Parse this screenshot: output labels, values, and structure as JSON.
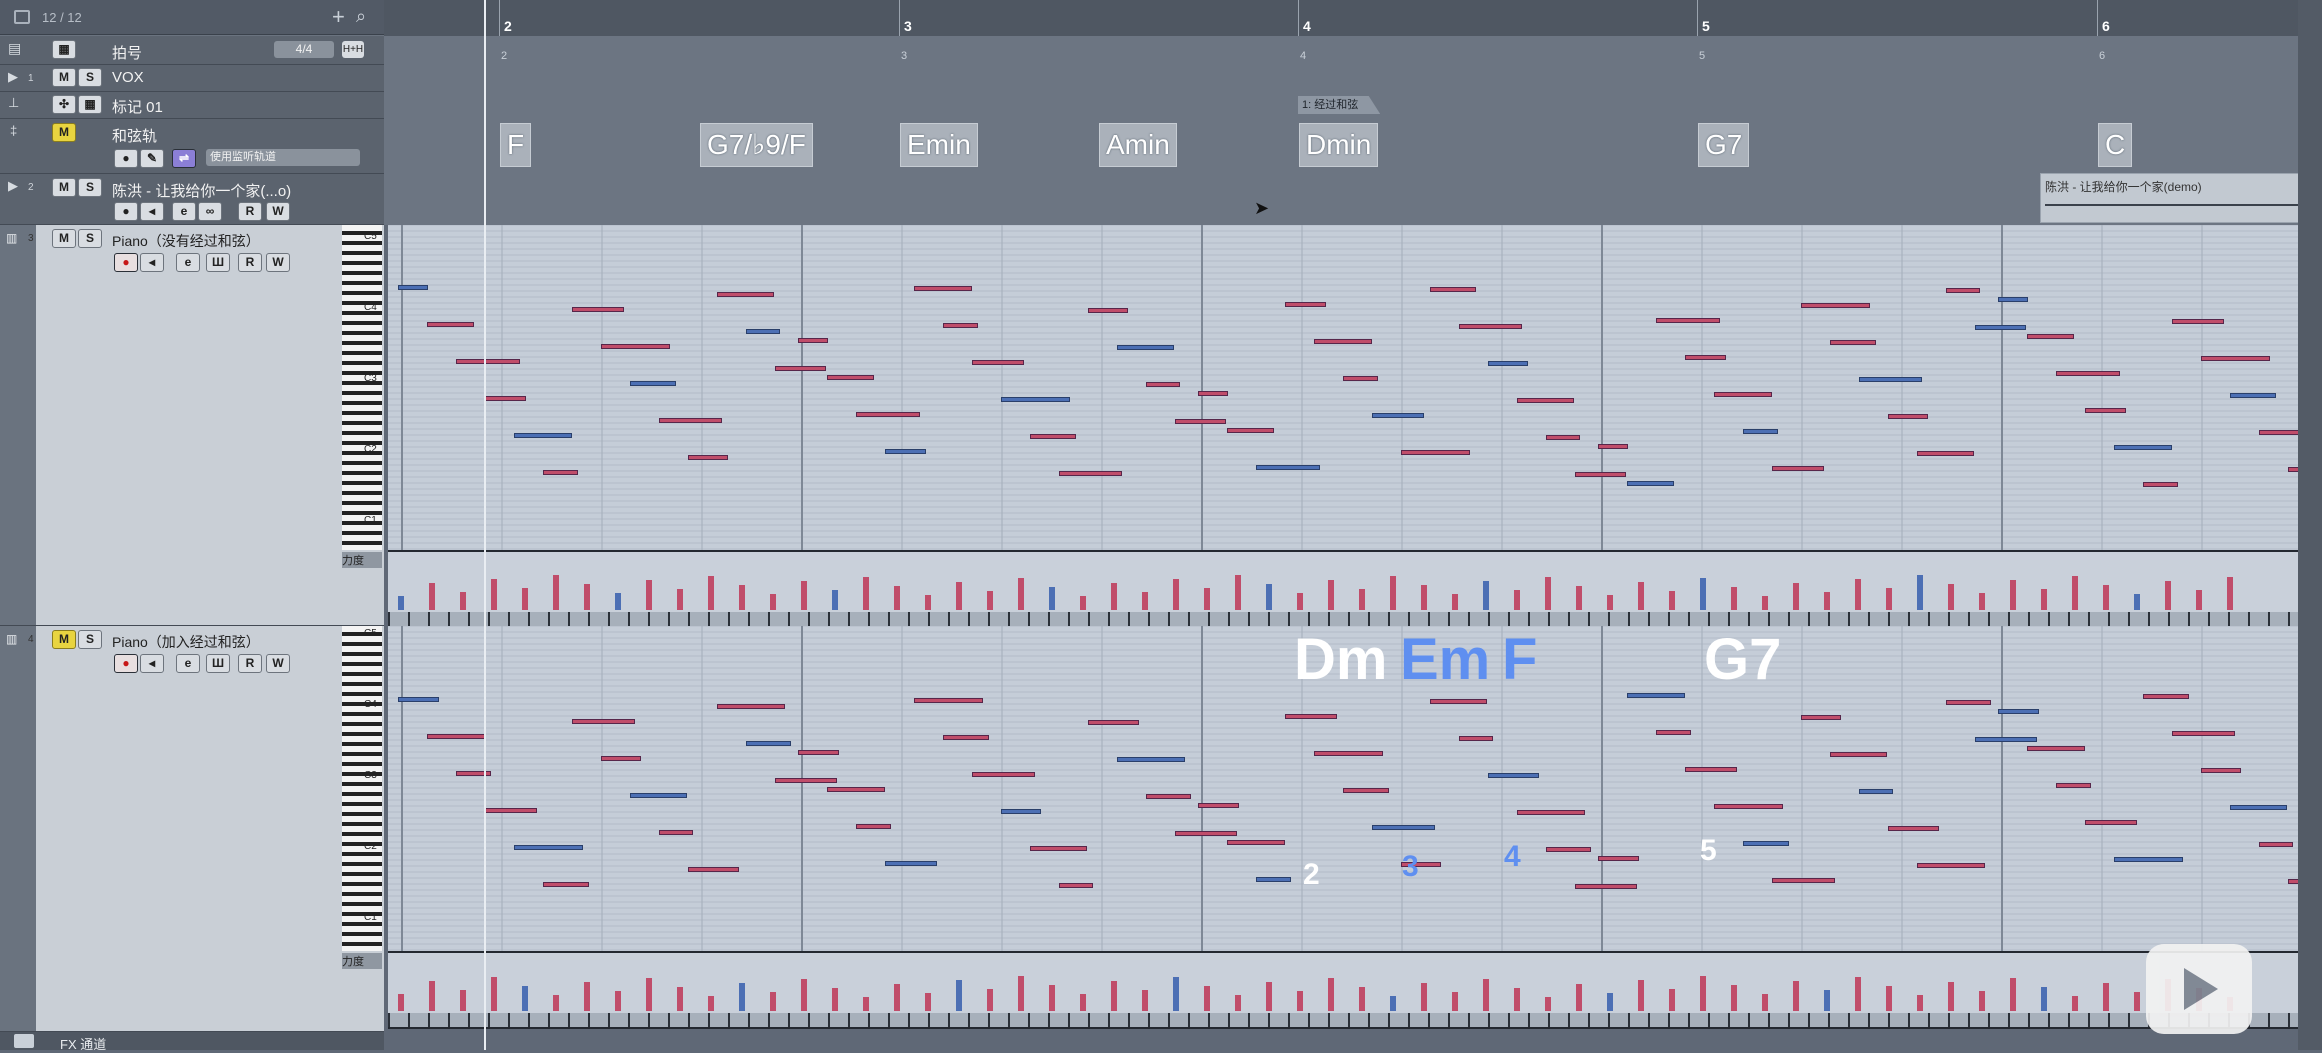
{
  "header": {
    "track_count": "12 / 12",
    "signature_label": "拍号",
    "signature_value": "4/4",
    "add_icon": "plus-icon",
    "search_icon": "search-icon"
  },
  "tracks": {
    "vox": {
      "number": "1",
      "name": "VOX"
    },
    "marker": {
      "name": "标记 01"
    },
    "chord": {
      "name": "和弦轨",
      "monitor_label": "使用监听轨道"
    },
    "audio": {
      "number": "2",
      "name": "陈洪 - 让我给你一个家(...o)"
    },
    "piano1": {
      "number": "3",
      "name": "Piano（没有经过和弦）"
    },
    "piano2": {
      "number": "4",
      "name": "Piano（加入经过和弦）"
    }
  },
  "buttons": {
    "m": "M",
    "s": "S",
    "r": "R",
    "w": "W",
    "e": "e"
  },
  "footer": {
    "fx_label": "FX 通道"
  },
  "ruler": {
    "bars": [
      "2",
      "3",
      "4",
      "5",
      "6"
    ],
    "sub_bars": [
      "2",
      "3",
      "4",
      "5",
      "6"
    ]
  },
  "marker_event": "1: 经过和弦",
  "chords": [
    "F",
    "G7/♭9/F",
    "Emin",
    "Amin",
    "Dmin",
    "G7",
    "C"
  ],
  "audio_event": "陈洪 - 让我给你一个家(demo)",
  "keyboard": {
    "octaves_top": [
      "C5",
      "C4",
      "C3",
      "C2",
      "C1"
    ],
    "octaves_bottom": [
      "C5",
      "C4",
      "C3",
      "C2",
      "C1"
    ],
    "velocity_label": "力度"
  },
  "annotations": {
    "passing_chords": [
      "Dm",
      "Em",
      "F",
      "G7"
    ],
    "steps": [
      "2",
      "3",
      "4",
      "5"
    ]
  },
  "colors": {
    "note_red": "#c04d6a",
    "note_blue": "#4c6fb4",
    "passing_blue": "#5f8ff0",
    "chord_box": "#aab1ba"
  }
}
